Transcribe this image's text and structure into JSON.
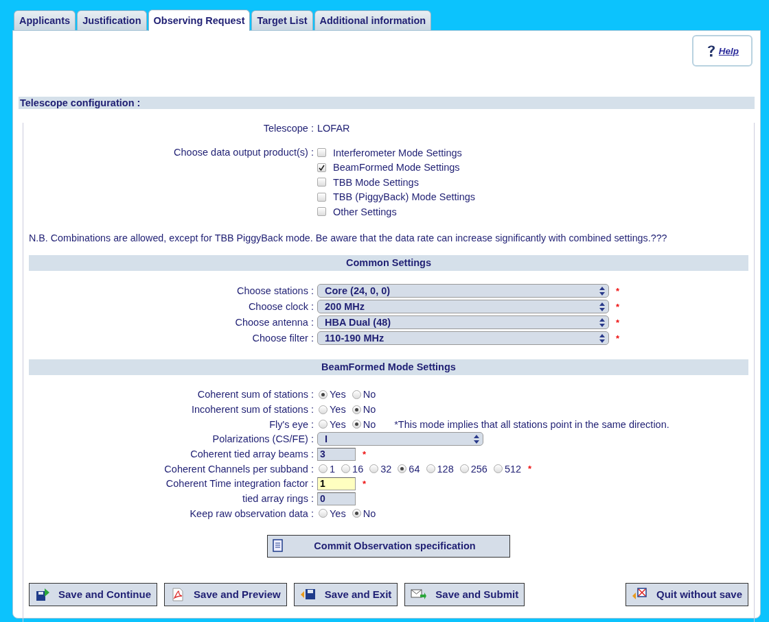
{
  "tabs": [
    {
      "label": "Applicants",
      "selected": false
    },
    {
      "label": "Justification",
      "selected": false
    },
    {
      "label": "Observing Request",
      "selected": true
    },
    {
      "label": "Target List",
      "selected": false
    },
    {
      "label": "Additional information",
      "selected": false
    }
  ],
  "help_link": "Help",
  "section_title": "Telescope configuration :",
  "telescope": {
    "label": "Telescope :",
    "value": "LOFAR"
  },
  "output_products": {
    "label": "Choose data output product(s) :",
    "options": [
      {
        "label": "Interferometer Mode Settings",
        "checked": false
      },
      {
        "label": "BeamFormed Mode Settings",
        "checked": true
      },
      {
        "label": "TBB Mode Settings",
        "checked": false
      },
      {
        "label": "TBB (PiggyBack) Mode Settings",
        "checked": false
      },
      {
        "label": "Other Settings",
        "checked": false
      }
    ]
  },
  "note": "N.B. Combinations are allowed, except for TBB PiggyBack mode. Be aware that the data rate can increase significantly with combined settings.???",
  "common_settings": {
    "title": "Common Settings",
    "fields": [
      {
        "label": "Choose stations :",
        "value": "Core (24, 0, 0)",
        "required_mark": "*"
      },
      {
        "label": "Choose clock :",
        "value": "200 MHz",
        "required_mark": "*"
      },
      {
        "label": "Choose antenna :",
        "value": "HBA Dual (48)",
        "required_mark": "*"
      },
      {
        "label": "Choose filter :",
        "value": "110-190 MHz",
        "required_mark": "*"
      }
    ]
  },
  "beamformed_settings": {
    "title": "BeamFormed Mode Settings",
    "rows": [
      {
        "kind": "radio",
        "label": "Coherent sum of stations :",
        "options": [
          {
            "label": "Yes",
            "selected": true
          },
          {
            "label": "No",
            "selected": false
          }
        ]
      },
      {
        "kind": "radio",
        "label": "Incoherent sum of stations :",
        "options": [
          {
            "label": "Yes",
            "selected": false
          },
          {
            "label": "No",
            "selected": true
          }
        ]
      },
      {
        "kind": "radio",
        "label": "Fly's eye :",
        "options": [
          {
            "label": "Yes",
            "selected": false
          },
          {
            "label": "No",
            "selected": true
          }
        ],
        "note": "*This mode implies that all stations point in the same direction."
      },
      {
        "kind": "select",
        "label": "Polarizations (CS/FE) :",
        "value": "I"
      },
      {
        "kind": "input",
        "label": "Coherent tied array beams :",
        "value": "3",
        "highlighted": false,
        "required_mark": "*"
      },
      {
        "kind": "radio",
        "label": "Coherent Channels per subband :",
        "options": [
          {
            "label": "1",
            "selected": false
          },
          {
            "label": "16",
            "selected": false
          },
          {
            "label": "32",
            "selected": false
          },
          {
            "label": "64",
            "selected": true
          },
          {
            "label": "128",
            "selected": false
          },
          {
            "label": "256",
            "selected": false
          },
          {
            "label": "512",
            "selected": false
          }
        ],
        "required_mark": "*"
      },
      {
        "kind": "input",
        "label": "Coherent Time integration factor :",
        "value": "1",
        "highlighted": true,
        "required_mark": "*"
      },
      {
        "kind": "input",
        "label": "tied array rings :",
        "value": "0",
        "highlighted": false
      },
      {
        "kind": "radio",
        "label": "Keep raw observation data :",
        "options": [
          {
            "label": "Yes",
            "selected": false
          },
          {
            "label": "No",
            "selected": true
          }
        ]
      }
    ]
  },
  "commit_button": "Commit Observation specification",
  "buttons": [
    {
      "kind": "continue",
      "label": "Save and Continue"
    },
    {
      "kind": "preview",
      "label": "Save and Preview"
    },
    {
      "kind": "exit",
      "label": "Save and Exit"
    },
    {
      "kind": "submit",
      "label": "Save and Submit"
    },
    {
      "kind": "quit",
      "label": "Quit without save"
    }
  ]
}
